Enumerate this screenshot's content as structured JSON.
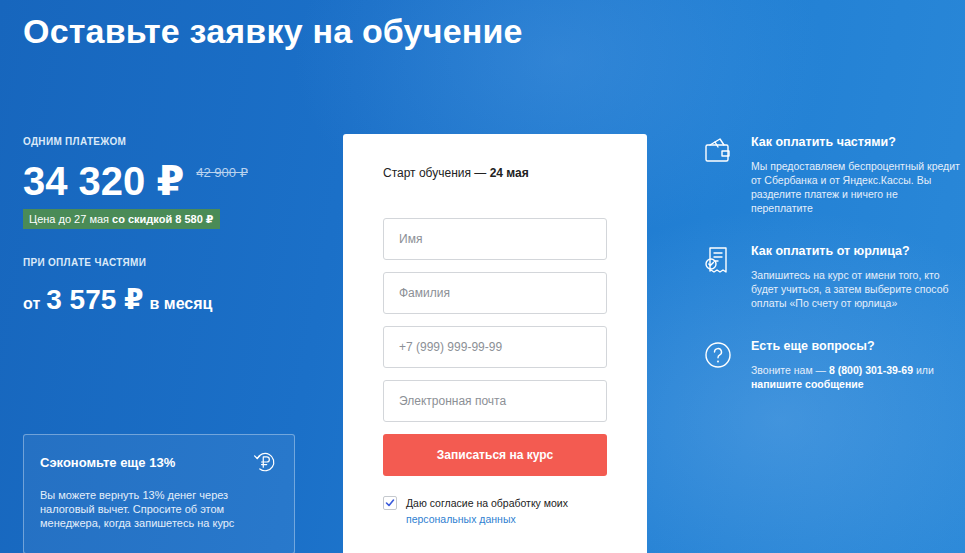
{
  "title": "Оставьте заявку на обучение",
  "single_payment": {
    "label": "ОДНИМ ПЛАТЕЖОМ",
    "price": "34 320 ₽",
    "old_price": "42 900 ₽",
    "badge": {
      "text": "Цена до 27 мая ",
      "bold": "со скидкой 8 580 ₽"
    }
  },
  "installments": {
    "label": "ПРИ ОПЛАТЕ ЧАСТЯМИ",
    "prefix": "от",
    "price": "3 575 ₽",
    "suffix": "в месяц"
  },
  "savings": {
    "title": "Сэкономьте еще 13%",
    "text": "Вы можете вернуть 13% денег через налоговый вычет. Спросите об этом менеджера, когда запишетесь на курс"
  },
  "form": {
    "start_label": "Старт обучения — ",
    "start_date": "24 мая",
    "fields": [
      {
        "placeholder": "Имя"
      },
      {
        "placeholder": "Фамилия"
      },
      {
        "placeholder": "+7 (999) 999-99-99"
      },
      {
        "placeholder": "Электронная почта"
      }
    ],
    "submit": "Записаться на курс",
    "consent": {
      "checked": true,
      "text": "Даю согласие на обработку моих",
      "link": "персональных данных"
    }
  },
  "info": [
    {
      "title": "Как оплатить частями?",
      "parts": [
        {
          "text": "Мы предоставляем беспроцентный кредит от Сбербанка и от Яндекс.Кассы. Вы разделите платеж и ничего не переплатите",
          "bold": false
        }
      ]
    },
    {
      "title": "Как оплатить от юрлица?",
      "parts": [
        {
          "text": "Запишитесь на курс от имени того, кто будет учиться, а затем выберите способ оплаты «По счету от юрлица»",
          "bold": false
        }
      ]
    },
    {
      "title": "Есть еще вопросы?",
      "parts": [
        {
          "text": "Звоните нам — ",
          "bold": false
        },
        {
          "text": "8 (800) 301-39-69",
          "bold": true
        },
        {
          "text": " или ",
          "bold": false
        },
        {
          "text": "напишите сообщение",
          "bold": true
        }
      ]
    }
  ]
}
